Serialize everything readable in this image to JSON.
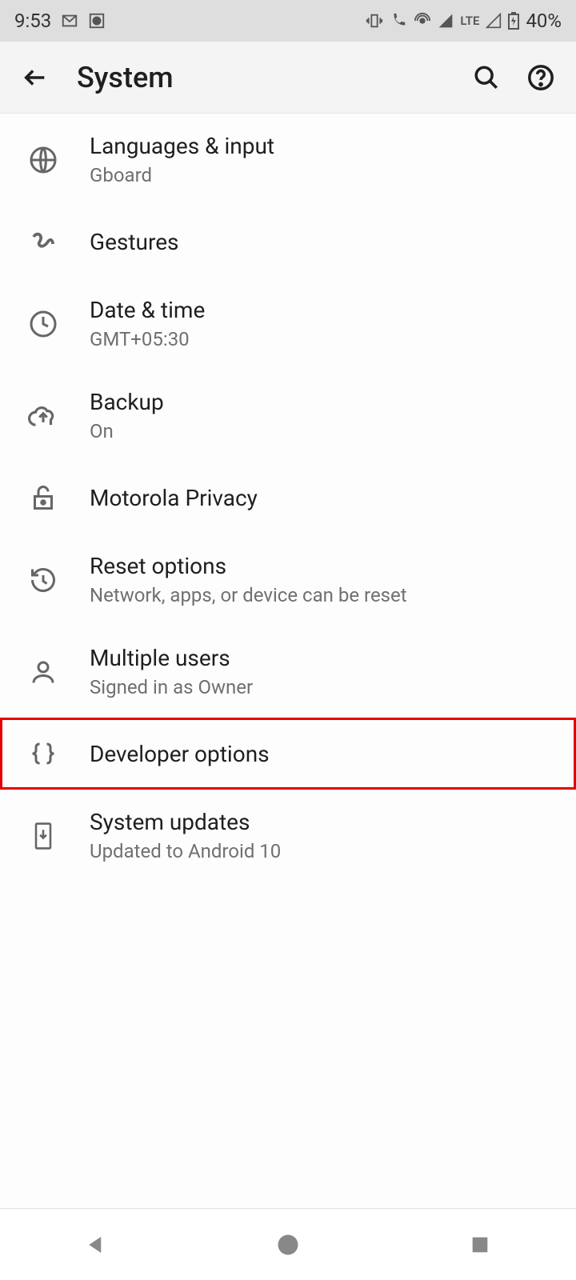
{
  "status": {
    "time": "9:53",
    "battery": "40%",
    "lte": "LTE"
  },
  "header": {
    "title": "System"
  },
  "items": [
    {
      "title": "Languages & input",
      "sub": "Gboard",
      "icon": "globe",
      "hl": false
    },
    {
      "title": "Gestures",
      "sub": "",
      "icon": "gesture",
      "hl": false
    },
    {
      "title": "Date & time",
      "sub": "GMT+05:30",
      "icon": "clock",
      "hl": false
    },
    {
      "title": "Backup",
      "sub": "On",
      "icon": "cloud-up",
      "hl": false
    },
    {
      "title": "Motorola Privacy",
      "sub": "",
      "icon": "lock-open",
      "hl": false
    },
    {
      "title": "Reset options",
      "sub": "Network, apps, or device can be reset",
      "icon": "restore",
      "hl": false
    },
    {
      "title": "Multiple users",
      "sub": "Signed in as Owner",
      "icon": "person",
      "hl": false
    },
    {
      "title": "Developer options",
      "sub": "",
      "icon": "braces",
      "hl": true
    },
    {
      "title": "System updates",
      "sub": "Updated to Android 10",
      "icon": "phone-down",
      "hl": false
    }
  ]
}
